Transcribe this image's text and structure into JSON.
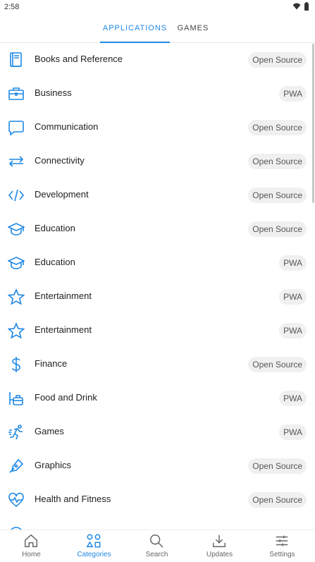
{
  "status": {
    "time": "2:58"
  },
  "tabs": {
    "applications": "APPLICATIONS",
    "games": "GAMES",
    "active": "applications"
  },
  "categories": [
    {
      "label": "Books and Reference",
      "badge": "Open Source",
      "icon": "book-icon"
    },
    {
      "label": "Business",
      "badge": "PWA",
      "icon": "briefcase-icon"
    },
    {
      "label": "Communication",
      "badge": "Open Source",
      "icon": "chat-bubble-icon"
    },
    {
      "label": "Connectivity",
      "badge": "Open Source",
      "icon": "arrows-icon"
    },
    {
      "label": "Development",
      "badge": "Open Source",
      "icon": "code-icon"
    },
    {
      "label": "Education",
      "badge": "Open Source",
      "icon": "graduation-cap-icon"
    },
    {
      "label": "Education",
      "badge": "PWA",
      "icon": "graduation-cap-icon"
    },
    {
      "label": "Entertainment",
      "badge": "PWA",
      "icon": "star-icon"
    },
    {
      "label": "Entertainment",
      "badge": "PWA",
      "icon": "star-icon"
    },
    {
      "label": "Finance",
      "badge": "Open Source",
      "icon": "dollar-icon"
    },
    {
      "label": "Food and Drink",
      "badge": "PWA",
      "icon": "food-icon"
    },
    {
      "label": "Games",
      "badge": "PWA",
      "icon": "running-icon"
    },
    {
      "label": "Graphics",
      "badge": "Open Source",
      "icon": "pen-icon"
    },
    {
      "label": "Health and Fitness",
      "badge": "Open Source",
      "icon": "heart-pulse-icon"
    }
  ],
  "bottom_nav": [
    {
      "label": "Home",
      "icon": "home-icon",
      "active": false
    },
    {
      "label": "Categories",
      "icon": "categories-icon",
      "active": true
    },
    {
      "label": "Search",
      "icon": "search-icon",
      "active": false
    },
    {
      "label": "Updates",
      "icon": "download-icon",
      "active": false
    },
    {
      "label": "Settings",
      "icon": "sliders-icon",
      "active": false
    }
  ],
  "colors": {
    "accent": "#1e88e5",
    "icon_blue": "#1e88e5",
    "badge_bg": "#f0f0f0"
  }
}
